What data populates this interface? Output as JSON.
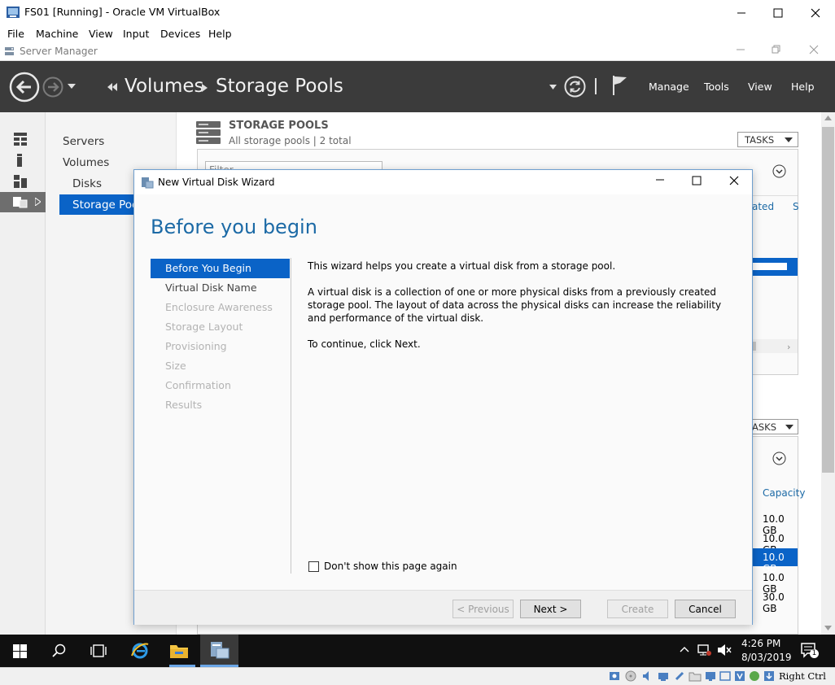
{
  "vbox": {
    "title": "FS01 [Running] - Oracle VM VirtualBox",
    "menu": [
      "File",
      "Machine",
      "View",
      "Input",
      "Devices",
      "Help"
    ],
    "status_text": "Right Ctrl"
  },
  "server_manager": {
    "title": "Server Manager",
    "breadcrumb": [
      "Volumes",
      "Storage Pools"
    ],
    "header_menu": [
      "Manage",
      "Tools",
      "View",
      "Help"
    ],
    "nav": {
      "items": [
        "Servers",
        "Volumes",
        "Disks",
        "Storage Pools"
      ],
      "selected": "Storage Pools"
    },
    "storage_pools": {
      "title": "STORAGE POOLS",
      "subtitle": "All storage pools | 2 total",
      "tasks_label": "TASKS",
      "filter_placeholder": "Filter",
      "column_partial": "ated",
      "column_partial2": "S"
    },
    "physical_disks": {
      "tasks_label": "ASKS",
      "capacity_header": "Capacity",
      "capacities": [
        "10.0 GB",
        "10.0 GB",
        "10.0 GB",
        "10.0 GB",
        "30.0 GB"
      ],
      "selected_index": 2
    }
  },
  "wizard": {
    "title": "New Virtual Disk Wizard",
    "heading": "Before you begin",
    "steps": [
      {
        "label": "Before You Begin",
        "state": "active"
      },
      {
        "label": "Virtual Disk Name",
        "state": "enabled"
      },
      {
        "label": "Enclosure Awareness",
        "state": "disabled"
      },
      {
        "label": "Storage Layout",
        "state": "disabled"
      },
      {
        "label": "Provisioning",
        "state": "disabled"
      },
      {
        "label": "Size",
        "state": "disabled"
      },
      {
        "label": "Confirmation",
        "state": "disabled"
      },
      {
        "label": "Results",
        "state": "disabled"
      }
    ],
    "paragraphs": [
      "This wizard helps you create a virtual disk from a storage pool.",
      "A virtual disk is a collection of one or more physical disks from a previously created storage pool. The layout of data across the physical disks can increase the reliability and performance of the virtual disk.",
      "To continue, click Next."
    ],
    "checkbox_label": "Don't show this page again",
    "checkbox_checked": false,
    "buttons": {
      "previous": "< Previous",
      "next": "Next >",
      "create": "Create",
      "cancel": "Cancel"
    }
  },
  "taskbar": {
    "time": "4:26 PM",
    "date": "8/03/2019",
    "notification_count": "1"
  },
  "colors": {
    "accent": "#0a63c7",
    "header": "#3b3b3b",
    "heading": "#1c6aa6"
  }
}
